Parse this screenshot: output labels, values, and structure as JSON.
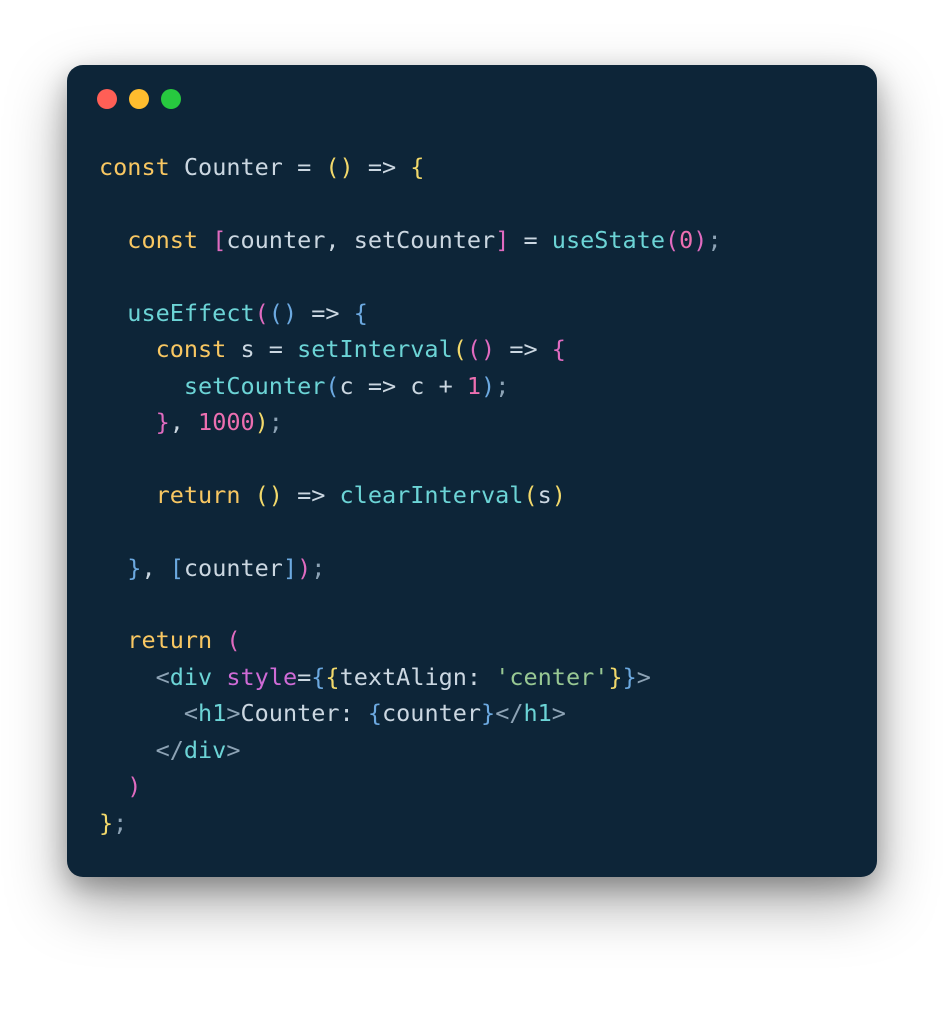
{
  "window": {
    "dots": {
      "red": "#ff5f56",
      "yellow": "#ffbd2e",
      "green": "#27c93f"
    }
  },
  "code": {
    "l1_const": "const",
    "l1_name": " Counter ",
    "l1_eq": "= ",
    "l1_paren": "()",
    "l1_arrow": " => ",
    "l1_open": "{",
    "l3_indent": "  ",
    "l3_const": "const",
    "l3_sp": " ",
    "l3_lb": "[",
    "l3_vars": "counter, setCounter",
    "l3_rb": "]",
    "l3_eq": " = ",
    "l3_fn": "useState",
    "l3_lp": "(",
    "l3_num": "0",
    "l3_rp": ")",
    "l3_semi": ";",
    "l5_indent": "  ",
    "l5_fn": "useEffect",
    "l5_lp1": "(",
    "l5_lp2": "()",
    "l5_arrow": " => ",
    "l5_open": "{",
    "l6_indent": "    ",
    "l6_const": "const",
    "l6_var": " s ",
    "l6_eq": "= ",
    "l6_fn": "setInterval",
    "l6_lp1": "(",
    "l6_lp2": "()",
    "l6_arrow": " => ",
    "l6_open": "{",
    "l7_indent": "      ",
    "l7_fn": "setCounter",
    "l7_lp": "(",
    "l7_arg": "c ",
    "l7_arrow": "=> ",
    "l7_expr": "c + ",
    "l7_num": "1",
    "l7_rp": ")",
    "l7_semi": ";",
    "l8_indent": "    ",
    "l8_close": "}",
    "l8_comma": ", ",
    "l8_num": "1000",
    "l8_rp": ")",
    "l8_semi": ";",
    "l10_indent": "    ",
    "l10_return": "return",
    "l10_sp": " ",
    "l10_lp": "()",
    "l10_arrow": " => ",
    "l10_fn": "clearInterval",
    "l10_lp2": "(",
    "l10_arg": "s",
    "l10_rp2": ")",
    "l12_indent": "  ",
    "l12_close": "}",
    "l12_comma": ", ",
    "l12_lb": "[",
    "l12_var": "counter",
    "l12_rb": "]",
    "l12_rp": ")",
    "l12_semi": ";",
    "l14_indent": "  ",
    "l14_return": "return",
    "l14_sp": " ",
    "l14_lp": "(",
    "l15_indent": "    ",
    "l15_la": "<",
    "l15_tag": "div",
    "l15_sp": " ",
    "l15_attr": "style",
    "l15_eq": "=",
    "l15_oc1": "{",
    "l15_oc2": "{",
    "l15_prop": "textAlign: ",
    "l15_str": "'center'",
    "l15_cc2": "}",
    "l15_cc1": "}",
    "l15_ra": ">",
    "l16_indent": "      ",
    "l16_la": "<",
    "l16_tag": "h1",
    "l16_ra": ">",
    "l16_text": "Counter: ",
    "l16_oc": "{",
    "l16_var": "counter",
    "l16_cc": "}",
    "l16_la2": "</",
    "l16_tag2": "h1",
    "l16_ra2": ">",
    "l17_indent": "    ",
    "l17_la": "</",
    "l17_tag": "div",
    "l17_ra": ">",
    "l18_indent": "  ",
    "l18_rp": ")",
    "l19_close": "}",
    "l19_semi": ";"
  }
}
